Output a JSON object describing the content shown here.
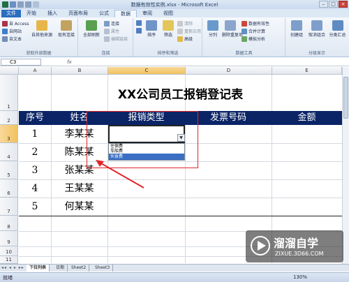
{
  "window": {
    "title": "数据有效性实例.xlsx - Microsoft Excel"
  },
  "ribbon": {
    "tabs": [
      "文件",
      "开始",
      "插入",
      "页面布局",
      "公式",
      "数据",
      "审阅",
      "视图"
    ],
    "active_tab": "数据",
    "groups": [
      {
        "label": "获取外部数据",
        "items": [
          "自 Access",
          "自网站",
          "自文本",
          "自其他来源",
          "现有连接"
        ]
      },
      {
        "label": "连接",
        "items": [
          "全部刷新",
          "连接",
          "属性",
          "编辑链接"
        ]
      },
      {
        "label": "排序和筛选",
        "items": [
          "排序",
          "筛选",
          "清除",
          "重新应用",
          "高级"
        ]
      },
      {
        "label": "数据工具",
        "items": [
          "分列",
          "删除重复项",
          "数据有效性",
          "合并计算",
          "模拟分析"
        ]
      },
      {
        "label": "分级显示",
        "items": [
          "创建组",
          "取消组合",
          "分类汇总"
        ]
      }
    ]
  },
  "formula_bar": {
    "name_box": "C3",
    "fx": "fx",
    "value": ""
  },
  "grid": {
    "columns": [
      "A",
      "B",
      "C",
      "D",
      "E"
    ],
    "active_column": "C",
    "rows": [
      "1",
      "2",
      "3",
      "4",
      "5",
      "6",
      "7",
      "8",
      "9",
      "10",
      "11"
    ],
    "active_row": "3"
  },
  "sheet": {
    "title": "XX公司员工报销登记表",
    "headers": [
      "序号",
      "姓名",
      "报销类型",
      "发票号码",
      "金额"
    ],
    "records": [
      {
        "no": "1",
        "name": "李某某"
      },
      {
        "no": "2",
        "name": "陈某某"
      },
      {
        "no": "3",
        "name": "张某某"
      },
      {
        "no": "4",
        "name": "王某某"
      },
      {
        "no": "5",
        "name": "何某某"
      }
    ]
  },
  "dropdown": {
    "options": [
      "住宿费",
      "车船费",
      "伙食费"
    ],
    "highlighted": "伙食费"
  },
  "sheet_tabs": [
    "下拉列表",
    "日期",
    "Sheet2",
    "Sheet3"
  ],
  "active_sheet_tab": "下拉列表",
  "status": {
    "ready": "就绪",
    "zoom": "130%"
  },
  "watermark": {
    "name": "溜溜自学",
    "url": "ZIXUE.3D66.COM"
  },
  "colors": {
    "header_fill": "#0a2466",
    "highlight_box": "#e0262a",
    "selected_option": "#3a6fc4",
    "file_tab": "#2b6dbf"
  }
}
